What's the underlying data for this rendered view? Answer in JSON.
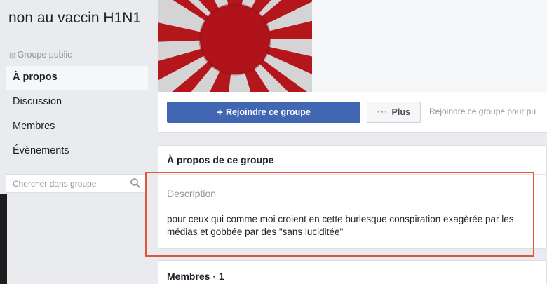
{
  "group": {
    "name": "non au vaccin H1N1",
    "type": "Groupe public",
    "type_icon": "globe-icon"
  },
  "sidebar": {
    "items": [
      {
        "label": "À propos",
        "active": true
      },
      {
        "label": "Discussion",
        "active": false
      },
      {
        "label": "Membres",
        "active": false
      },
      {
        "label": "Évènements",
        "active": false
      }
    ],
    "search_placeholder": "Chercher dans groupe",
    "search_icon": "search-icon"
  },
  "actions": {
    "join_label": "Rejoindre ce groupe",
    "more_label": "Plus",
    "join_hint": "Rejoindre ce groupe pour pu"
  },
  "about": {
    "title": "À propos de ce groupe",
    "description_label": "Description",
    "description_text": "pour ceux qui comme moi croient en cette burlesque conspiration exagèrée par les médias et gobbée par des \"sans luciditée\""
  },
  "members": {
    "title": "Membres · 1"
  },
  "colors": {
    "primary_button": "#4267b2",
    "highlight_border": "#e0563a",
    "cover_red": "#b5161c"
  }
}
